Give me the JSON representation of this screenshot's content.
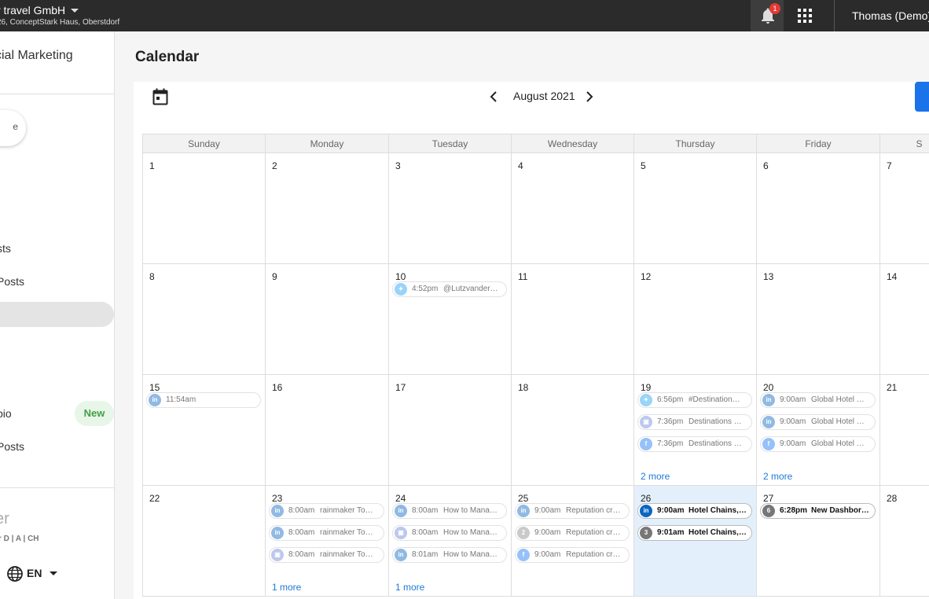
{
  "topbar": {
    "org_name": "r travel GmbH",
    "org_address": "26, ConceptStark Haus, Oberstdorf",
    "notification_count": "1",
    "user_name": "Thomas (Demo)"
  },
  "sidebar": {
    "title": "cial Marketing",
    "pill_label": "e",
    "items": [
      {
        "label": "sts"
      },
      {
        "label": " Posts"
      },
      {
        "label": ""
      },
      {
        "label": "pio"
      },
      {
        "label": "Posts"
      }
    ],
    "new_badge": "New",
    "brand_text": "er",
    "region_text": "r D | A | CH",
    "language": "EN"
  },
  "main": {
    "page_title": "Calendar",
    "month_label": "August 2021",
    "weekdays": [
      "Sunday",
      "Monday",
      "Tuesday",
      "Wednesday",
      "Thursday",
      "Friday",
      "S"
    ],
    "weeks": [
      [
        {
          "day": "1",
          "events": []
        },
        {
          "day": "2",
          "events": []
        },
        {
          "day": "3",
          "events": []
        },
        {
          "day": "4",
          "events": []
        },
        {
          "day": "5",
          "events": []
        },
        {
          "day": "6",
          "events": []
        },
        {
          "day": "7",
          "events": []
        }
      ],
      [
        {
          "day": "8",
          "events": []
        },
        {
          "day": "9",
          "events": []
        },
        {
          "day": "10",
          "events": [
            {
              "icon": "twitter-icon",
              "type": "tw",
              "time": "4:52pm",
              "text": "@Lutzvander…"
            }
          ]
        },
        {
          "day": "11",
          "events": []
        },
        {
          "day": "12",
          "events": []
        },
        {
          "day": "13",
          "events": []
        },
        {
          "day": "14",
          "events": []
        }
      ],
      [
        {
          "day": "15",
          "events": [
            {
              "icon": "linkedin-icon",
              "type": "li",
              "time": "11:54am",
              "text": ""
            }
          ]
        },
        {
          "day": "16",
          "events": []
        },
        {
          "day": "17",
          "events": []
        },
        {
          "day": "18",
          "events": []
        },
        {
          "day": "19",
          "events": [
            {
              "icon": "twitter-icon",
              "type": "tw",
              "time": "6:56pm",
              "text": "#Destination…"
            },
            {
              "icon": "google-my-business-icon",
              "type": "gm",
              "time": "7:36pm",
              "text": "Destinations …"
            },
            {
              "icon": "facebook-icon",
              "type": "fb",
              "time": "7:36pm",
              "text": "Destinations …"
            }
          ],
          "more": "2 more"
        },
        {
          "day": "20",
          "events": [
            {
              "icon": "linkedin-icon",
              "type": "li",
              "time": "9:00am",
              "text": "Global Hotel …"
            },
            {
              "icon": "linkedin-icon",
              "type": "li",
              "time": "9:00am",
              "text": "Global Hotel …"
            },
            {
              "icon": "facebook-icon",
              "type": "fb",
              "time": "9:00am",
              "text": "Global Hotel …"
            }
          ],
          "more": "2 more"
        },
        {
          "day": "21",
          "events": []
        }
      ],
      [
        {
          "day": "22",
          "events": []
        },
        {
          "day": "23",
          "events": [
            {
              "icon": "linkedin-icon",
              "type": "li",
              "time": "8:00am",
              "text": "rainmaker To…"
            },
            {
              "icon": "linkedin-icon",
              "type": "li",
              "time": "8:00am",
              "text": "rainmaker To…"
            },
            {
              "icon": "google-my-business-icon",
              "type": "gm",
              "time": "8:00am",
              "text": "rainmaker To…"
            }
          ],
          "more": "1 more"
        },
        {
          "day": "24",
          "events": [
            {
              "icon": "linkedin-icon",
              "type": "li",
              "time": "8:00am",
              "text": "How to Mana…"
            },
            {
              "icon": "google-my-business-icon",
              "type": "gm",
              "time": "8:00am",
              "text": "How to Mana…"
            },
            {
              "icon": "linkedin-icon",
              "type": "li",
              "time": "8:01am",
              "text": "How to Mana…"
            }
          ],
          "more": "1 more"
        },
        {
          "day": "25",
          "events": [
            {
              "icon": "linkedin-icon",
              "type": "li",
              "time": "9:00am",
              "text": "Reputation cr…"
            },
            {
              "icon": "group-count-icon",
              "type": "num",
              "num": "2",
              "time": "9:00am",
              "text": "Reputation cr…"
            },
            {
              "icon": "facebook-icon",
              "type": "fb",
              "time": "9:00am",
              "text": "Reputation cr…"
            }
          ]
        },
        {
          "day": "26",
          "today": true,
          "events": [
            {
              "icon": "linkedin-icon",
              "type": "li",
              "time": "9:00am",
              "text": "Hotel Chains,…",
              "strong": true
            },
            {
              "icon": "group-count-icon",
              "type": "num",
              "num": "3",
              "time": "9:01am",
              "text": "Hotel Chains,…",
              "strong": true
            }
          ]
        },
        {
          "day": "27",
          "events": [
            {
              "icon": "group-count-icon",
              "type": "num",
              "num": "6",
              "time": "6:28pm",
              "text": "New Dashbor…",
              "strong": true
            }
          ]
        },
        {
          "day": "28",
          "events": []
        }
      ]
    ]
  },
  "colors": {
    "topbar": "#2b2b2b",
    "accent": "#1a73e8",
    "today": "#e3f0fc",
    "link": "#1e7ad8",
    "new_badge_bg": "#e8f5e9",
    "new_badge_text": "#43a047"
  }
}
